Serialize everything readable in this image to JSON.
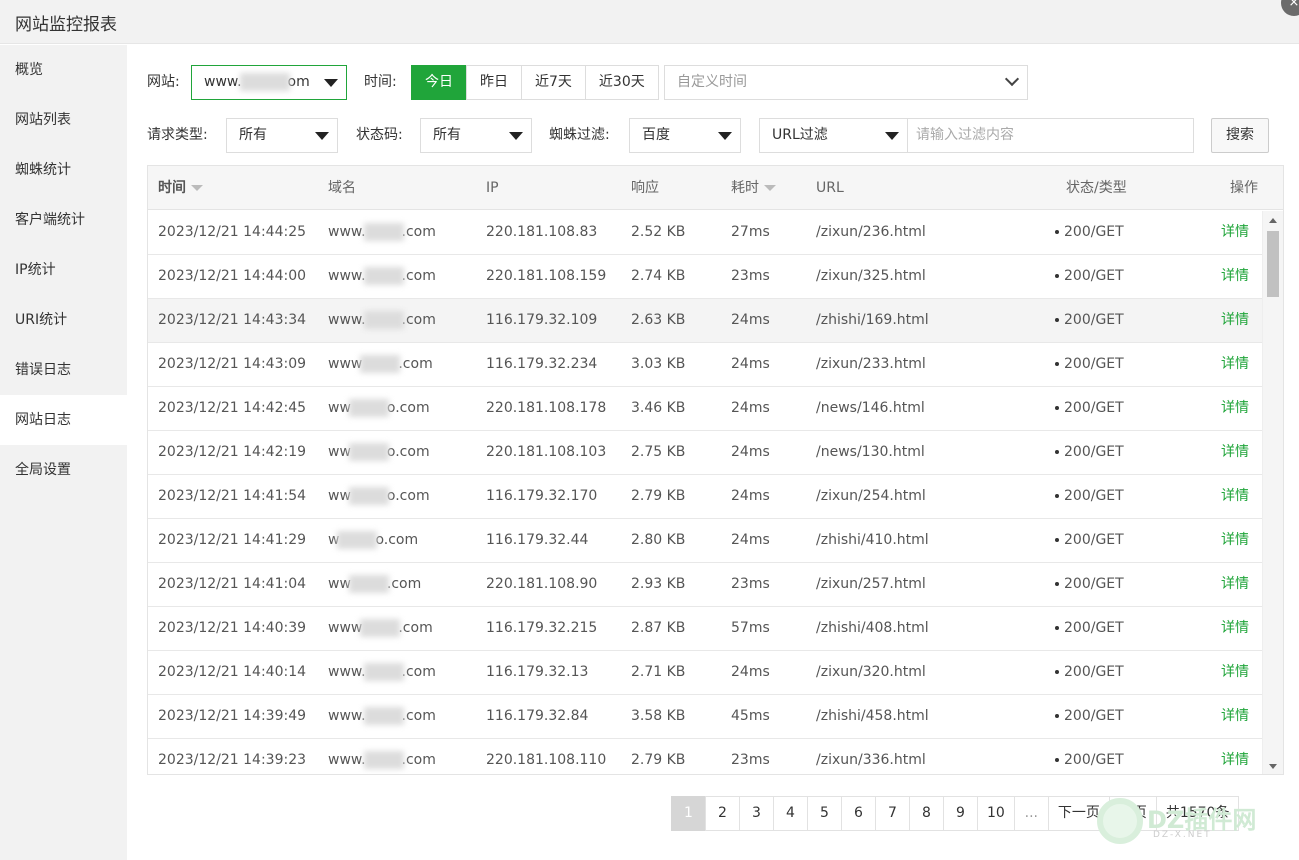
{
  "window": {
    "title": "网站监控报表",
    "close_label": "×"
  },
  "sidebar": {
    "items": [
      {
        "label": "概览",
        "active": false
      },
      {
        "label": "网站列表",
        "active": false
      },
      {
        "label": "蜘蛛统计",
        "active": false
      },
      {
        "label": "客户端统计",
        "active": false
      },
      {
        "label": "IP统计",
        "active": false
      },
      {
        "label": "URI统计",
        "active": false
      },
      {
        "label": "错误日志",
        "active": false
      },
      {
        "label": "网站日志",
        "active": true
      },
      {
        "label": "全局设置",
        "active": false
      }
    ]
  },
  "filters": {
    "site_label": "网站:",
    "site_value": "www.",
    "site_value_suffix": "om",
    "time_label": "时间:",
    "time_buttons": [
      "今日",
      "昨日",
      "近7天",
      "近30天"
    ],
    "time_active": "今日",
    "custom_time_placeholder": "自定义时间",
    "request_type_label": "请求类型:",
    "request_type_value": "所有",
    "status_code_label": "状态码:",
    "status_code_value": "所有",
    "spider_label": "蜘蛛过滤:",
    "spider_value": "百度",
    "url_filter_value": "URL过滤",
    "filter_placeholder": "请输入过滤内容",
    "search_label": "搜索"
  },
  "table": {
    "headers": {
      "time": "时间",
      "domain": "域名",
      "ip": "IP",
      "response": "响应",
      "duration": "耗时",
      "url": "URL",
      "status": "状态/类型",
      "action": "操作"
    },
    "rows": [
      {
        "time": "2023/12/21 14:44:25",
        "domain_pre": "www.",
        "domain_post": ".com",
        "ip": "220.181.108.83",
        "response": "2.52 KB",
        "duration": "27ms",
        "url": "/zixun/236.html",
        "status": "200/GET",
        "action": "详情"
      },
      {
        "time": "2023/12/21 14:44:00",
        "domain_pre": "www.",
        "domain_post": ".com",
        "ip": "220.181.108.159",
        "response": "2.74 KB",
        "duration": "23ms",
        "url": "/zixun/325.html",
        "status": "200/GET",
        "action": "详情"
      },
      {
        "time": "2023/12/21 14:43:34",
        "domain_pre": "www.",
        "domain_post": ".com",
        "ip": "116.179.32.109",
        "response": "2.63 KB",
        "duration": "24ms",
        "url": "/zhishi/169.html",
        "status": "200/GET",
        "action": "详情"
      },
      {
        "time": "2023/12/21 14:43:09",
        "domain_pre": "www",
        "domain_post": ".com",
        "ip": "116.179.32.234",
        "response": "3.03 KB",
        "duration": "24ms",
        "url": "/zixun/233.html",
        "status": "200/GET",
        "action": "详情"
      },
      {
        "time": "2023/12/21 14:42:45",
        "domain_pre": "ww",
        "domain_post": "o.com",
        "ip": "220.181.108.178",
        "response": "3.46 KB",
        "duration": "24ms",
        "url": "/news/146.html",
        "status": "200/GET",
        "action": "详情"
      },
      {
        "time": "2023/12/21 14:42:19",
        "domain_pre": "ww",
        "domain_post": "o.com",
        "ip": "220.181.108.103",
        "response": "2.75 KB",
        "duration": "24ms",
        "url": "/news/130.html",
        "status": "200/GET",
        "action": "详情"
      },
      {
        "time": "2023/12/21 14:41:54",
        "domain_pre": "ww",
        "domain_post": "o.com",
        "ip": "116.179.32.170",
        "response": "2.79 KB",
        "duration": "24ms",
        "url": "/zixun/254.html",
        "status": "200/GET",
        "action": "详情"
      },
      {
        "time": "2023/12/21 14:41:29",
        "domain_pre": "w",
        "domain_post": "o.com",
        "ip": "116.179.32.44",
        "response": "2.80 KB",
        "duration": "24ms",
        "url": "/zhishi/410.html",
        "status": "200/GET",
        "action": "详情"
      },
      {
        "time": "2023/12/21 14:41:04",
        "domain_pre": "ww",
        "domain_post": ".com",
        "ip": "220.181.108.90",
        "response": "2.93 KB",
        "duration": "23ms",
        "url": "/zixun/257.html",
        "status": "200/GET",
        "action": "详情"
      },
      {
        "time": "2023/12/21 14:40:39",
        "domain_pre": "www",
        "domain_post": ".com",
        "ip": "116.179.32.215",
        "response": "2.87 KB",
        "duration": "57ms",
        "url": "/zhishi/408.html",
        "status": "200/GET",
        "action": "详情"
      },
      {
        "time": "2023/12/21 14:40:14",
        "domain_pre": "www.",
        "domain_post": ".com",
        "ip": "116.179.32.13",
        "response": "2.71 KB",
        "duration": "24ms",
        "url": "/zixun/320.html",
        "status": "200/GET",
        "action": "详情"
      },
      {
        "time": "2023/12/21 14:39:49",
        "domain_pre": "www.",
        "domain_post": ".com",
        "ip": "116.179.32.84",
        "response": "3.58 KB",
        "duration": "45ms",
        "url": "/zhishi/458.html",
        "status": "200/GET",
        "action": "详情"
      },
      {
        "time": "2023/12/21 14:39:23",
        "domain_pre": "www.",
        "domain_post": ".com",
        "ip": "220.181.108.110",
        "response": "2.79 KB",
        "duration": "23ms",
        "url": "/zixun/336.html",
        "status": "200/GET",
        "action": "详情"
      }
    ],
    "highlighted_row": 2
  },
  "pagination": {
    "pages": [
      "1",
      "2",
      "3",
      "4",
      "5",
      "6",
      "7",
      "8",
      "9",
      "10",
      "..."
    ],
    "current": "1",
    "next_label": "下一页",
    "last_label": "尾页",
    "total_label": "共1570条"
  },
  "watermark": {
    "text": "DZ插件网",
    "sub": "DZ-X.NET"
  },
  "colors": {
    "accent": "#20a53a",
    "sidebar_bg": "#f2f2f2",
    "active_page_bg": "#d6d6d6"
  }
}
